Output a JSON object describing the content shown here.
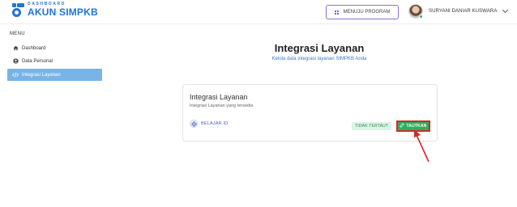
{
  "header": {
    "logo_small": "DASHBOARD",
    "logo_big": "AKUN SIMPKB",
    "menu_program_label": "MENUJU PROGRAM",
    "user_name": "SURYANI DANIAR KUSWARA"
  },
  "sidebar": {
    "menu_title": "MENU",
    "items": [
      {
        "label": "Dashboard",
        "icon": "home-icon",
        "active": false
      },
      {
        "label": "Data Personal",
        "icon": "user-circle-icon",
        "active": false
      },
      {
        "label": "Integrasi Layanan",
        "icon": "code-icon",
        "active": true
      }
    ]
  },
  "main": {
    "title": "Integrasi Layanan",
    "subtitle": "Kelola data integrasi layanan SIMPKB Anda"
  },
  "card": {
    "title": "Integrasi Layanan",
    "subtitle": "Integrasi Layanan yang tersedia",
    "service_name": "BELAJAR.ID",
    "status": "TIDAK TERTAUT",
    "button_label": "TAUTKAN"
  },
  "colors": {
    "brand_blue": "#1f74d6",
    "sidebar_active": "#78b4e6",
    "button_green": "#2eae5f",
    "highlight_red": "#d9262b"
  }
}
